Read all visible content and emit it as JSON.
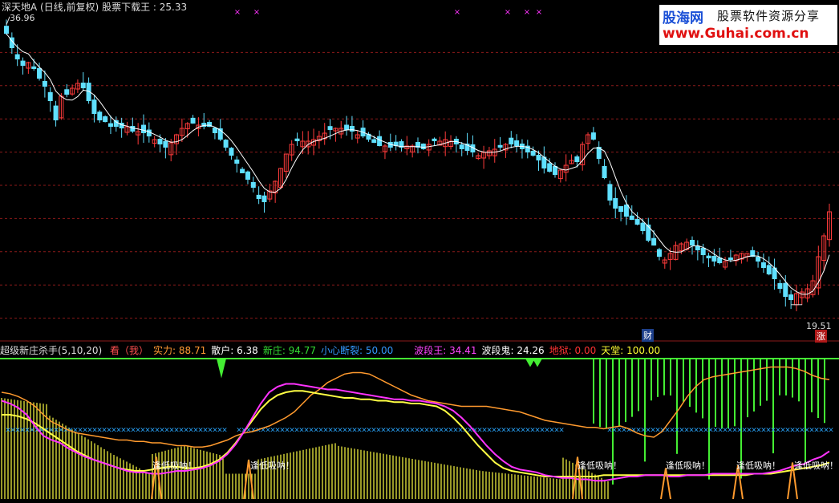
{
  "top_panel": {
    "title": "深天地A",
    "period": "(日线,前复权)",
    "indicator": "股票下载王",
    "value": ": 25.33",
    "high_label": "36.96",
    "low_label": "19.51",
    "badge_cai": "财",
    "badge_zhang": "涨"
  },
  "watermark": {
    "line1_brand": "股海网",
    "line1_text": "股票软件资源分享",
    "line2": "www.Guhai.com.cn"
  },
  "indicator_panel": {
    "name": "超级新庄杀手(5,10,20)",
    "items": [
      {
        "label": "看（我）",
        "color": "#ff5050"
      },
      {
        "label": "实力: 88.71",
        "color": "#ff9933"
      },
      {
        "label": "散户: 6.38",
        "color": "#ffffff"
      },
      {
        "label": "新庄: 94.77",
        "color": "#33dd33"
      },
      {
        "label": "小心断裂: 50.00",
        "color": "#3399ff"
      },
      {
        "label": "波段王: 34.41",
        "color": "#ff44ff"
      },
      {
        "label": "波段鬼: 24.26",
        "color": "#ffffff"
      },
      {
        "label": "地狱: 0.00",
        "color": "#ff3333"
      },
      {
        "label": "天堂: 100.00",
        "color": "#ffff33"
      }
    ],
    "signal_text": "逢低吸呐！"
  },
  "colors": {
    "up": "#ff3b3b",
    "down": "#5fe0ff",
    "grid": "#8b1a1a",
    "ma": "#ffffff",
    "green": "#44ee33",
    "yellow": "#ffff44",
    "orange": "#ff9a2e",
    "magenta": "#ff33ff",
    "blue_x": "#2aa7ff"
  },
  "chart_data": [
    {
      "type": "candlestick",
      "title": "深天地A (日线,前复权) 股票下载王",
      "last": 25.33,
      "ylim": [
        17.5,
        38.2
      ],
      "high_marker": 36.96,
      "low_marker": 19.51,
      "close": [
        36.4,
        35.5,
        34.8,
        34.4,
        34.6,
        34.2,
        33.6,
        33.1,
        32.2,
        31.0,
        32.5,
        32.6,
        33.0,
        33.3,
        33.0,
        32.2,
        31.4,
        31.0,
        30.9,
        30.6,
        30.6,
        30.5,
        30.6,
        30.3,
        30.3,
        30.2,
        30.0,
        29.8,
        29.5,
        29.3,
        29.6,
        30.1,
        30.5,
        30.8,
        30.8,
        30.7,
        30.6,
        30.6,
        30.2,
        29.8,
        29.3,
        28.8,
        28.3,
        27.7,
        27.3,
        26.8,
        26.1,
        25.9,
        26.6,
        27.2,
        28.0,
        28.9,
        29.5,
        29.7,
        29.7,
        29.7,
        29.8,
        30.0,
        30.2,
        30.4,
        30.5,
        30.5,
        30.4,
        30.3,
        30.1,
        30.0,
        29.8,
        29.6,
        29.4,
        29.4,
        29.3,
        29.4,
        29.3,
        29.4,
        29.4,
        29.3,
        29.2,
        29.5,
        29.7,
        29.7,
        29.8,
        29.7,
        29.5,
        29.2,
        29.1,
        29.0,
        28.8,
        29.0,
        29.1,
        29.2,
        29.3,
        29.5,
        29.5,
        29.4,
        29.2,
        29.0,
        28.8,
        28.5,
        28.0,
        27.8,
        27.6,
        27.9,
        28.2,
        28.5,
        28.4,
        29.5,
        30.1,
        29.8,
        28.6,
        27.4,
        26.0,
        25.5,
        25.3,
        25.0,
        24.8,
        24.5,
        24.1,
        23.5,
        23.2,
        22.5,
        22.3,
        22.7,
        23.2,
        23.3,
        23.4,
        23.2,
        22.9,
        22.6,
        22.4,
        22.2,
        22.1,
        22.2,
        22.3,
        22.6,
        22.7,
        22.7,
        22.5,
        22.2,
        21.8,
        21.4,
        21.1,
        20.5,
        20.0,
        19.8,
        20.2,
        20.3,
        20.5,
        21.0,
        22.5,
        23.8,
        25.3
      ]
    },
    {
      "type": "composite",
      "title": "超级新庄杀手(5,10,20)",
      "ylim": [
        0,
        100
      ],
      "series": [
        {
          "name": "实力",
          "values": [
            76,
            75,
            73,
            70,
            66,
            60,
            55,
            52,
            49,
            47,
            46,
            45,
            44,
            43,
            42,
            42,
            41,
            41,
            40,
            40,
            39,
            38,
            38,
            37,
            37,
            38,
            40,
            42,
            45,
            47,
            48,
            50,
            52,
            55,
            58,
            62,
            68,
            74,
            78,
            83,
            86,
            89,
            90,
            90,
            89,
            86,
            83,
            80,
            77,
            74,
            72,
            70,
            69,
            68,
            67,
            66,
            66,
            66,
            66,
            65,
            64,
            63,
            62,
            60,
            58,
            56,
            55,
            54,
            53,
            52,
            51,
            51,
            50,
            51,
            52,
            50,
            47,
            45,
            44,
            48,
            56,
            64,
            73,
            80,
            85,
            87,
            88,
            89,
            90,
            91,
            92,
            93,
            94,
            94,
            94,
            93,
            91,
            88,
            86,
            85
          ]
        },
        {
          "name": "散户",
          "values": [
            25,
            24,
            24,
            23,
            22,
            20,
            18,
            16,
            14,
            13,
            12,
            11,
            10,
            10,
            9,
            9,
            8,
            8,
            7,
            7,
            7,
            7,
            6,
            6,
            6,
            6,
            6,
            6,
            6,
            6,
            6,
            6,
            6,
            6,
            6,
            6,
            6,
            6,
            6,
            6,
            6,
            6,
            6,
            6,
            6,
            6,
            6,
            6,
            6,
            6,
            6,
            6,
            6,
            6,
            6,
            6,
            6,
            6,
            6,
            6,
            6,
            6,
            6,
            6,
            6,
            6,
            6,
            6,
            6,
            6,
            6,
            6,
            6,
            6,
            6,
            6,
            6,
            6,
            6,
            6,
            6,
            6,
            6,
            6,
            6,
            6,
            6,
            6,
            6,
            6,
            6,
            6,
            6,
            6,
            6,
            6,
            6,
            6,
            6,
            6
          ]
        },
        {
          "name": "新庄",
          "values": [
            94.77
          ]
        },
        {
          "name": "小心断裂",
          "values": [
            50.0
          ]
        },
        {
          "name": "波段王",
          "values": [
            70,
            68,
            65,
            60,
            52,
            45,
            42,
            40,
            36,
            33,
            30,
            28,
            26,
            24,
            22,
            20,
            19,
            19,
            18,
            18,
            19,
            20,
            20,
            21,
            22,
            24,
            27,
            32,
            39,
            48,
            58,
            68,
            76,
            80,
            82,
            82,
            81,
            80,
            79,
            78,
            78,
            77,
            76,
            75,
            74,
            73,
            72,
            71,
            71,
            70,
            70,
            69,
            68,
            66,
            63,
            58,
            52,
            45,
            38,
            32,
            27,
            23,
            21,
            20,
            19,
            17,
            16,
            15,
            15,
            14,
            14,
            13,
            13,
            14,
            15,
            16,
            16,
            17,
            17,
            17,
            16,
            16,
            17,
            17,
            17,
            18,
            18,
            18,
            18,
            18,
            18,
            18,
            19,
            20,
            22,
            24,
            25,
            28,
            30,
            34
          ]
        },
        {
          "name": "波段鬼",
          "values": [
            60,
            60,
            59,
            57,
            54,
            50,
            46,
            42,
            38,
            34,
            31,
            28,
            26,
            24,
            22,
            21,
            20,
            20,
            21,
            22,
            23,
            23,
            22,
            22,
            23,
            25,
            28,
            33,
            40,
            48,
            56,
            64,
            70,
            74,
            76,
            77,
            77,
            76,
            75,
            74,
            73,
            72,
            72,
            71,
            71,
            70,
            70,
            69,
            69,
            68,
            68,
            67,
            66,
            63,
            58,
            52,
            45,
            38,
            32,
            26,
            22,
            20,
            19,
            18,
            17,
            16,
            16,
            16,
            16,
            16,
            16,
            16,
            17,
            17,
            17,
            17,
            17,
            17,
            17,
            17,
            17,
            17,
            17,
            17,
            17,
            17,
            17,
            17,
            17,
            17,
            18,
            18,
            18,
            19,
            20,
            21,
            22,
            23,
            24,
            26
          ]
        },
        {
          "name": "地狱",
          "values": [
            0.0
          ]
        },
        {
          "name": "天堂",
          "values": [
            100.0
          ]
        }
      ]
    }
  ]
}
